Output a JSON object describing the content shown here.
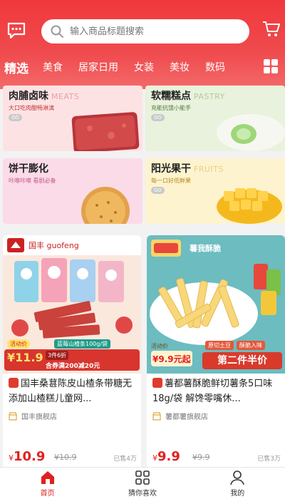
{
  "search": {
    "placeholder": "输入商品标题搜索"
  },
  "tabs": [
    "精选",
    "美食",
    "居家日用",
    "女装",
    "美妆",
    "数码"
  ],
  "categories": [
    {
      "title": "肉脯卤味",
      "en": "MEATS",
      "sub": "大口吃肉酣畅淋漓",
      "tag": "GO"
    },
    {
      "title": "软糯糕点",
      "en": "PASTRY",
      "sub": "充能抗饿小能手",
      "tag": "GO"
    },
    {
      "title": "饼干膨化",
      "en": "",
      "sub": "咔嚓咔嚓 看剧必备",
      "tag": "GO"
    },
    {
      "title": "阳光果干",
      "en": "FRUITS",
      "sub": "每一口好低鲜果",
      "tag": "GO"
    }
  ],
  "products": [
    {
      "title": "国丰桑葚陈皮山楂条带糖无添加山楂糕儿童网...",
      "shop": "国丰旗舰店",
      "price_symbol": "¥",
      "price": "10.9",
      "original": "¥10.9",
      "sold": "已售4万",
      "banner_brand": "国丰 guofeng",
      "banner_promo_label": "活动价",
      "banner_price": "¥11.9",
      "banner_promo": "3件6折",
      "banner_deal": "含券满200减20元",
      "banner_pack": "蓝莓山楂条100g/袋"
    },
    {
      "title": "薯都薯酥脆鲜切薯条5口味18g/袋 解馋零嘴休...",
      "shop": "薯都薯旗舰店",
      "price_symbol": "¥",
      "price": "9.9",
      "original": "¥9.9",
      "sold": "已售3万",
      "banner_brand": "薯我酥脆",
      "banner_promo_label": "活动价",
      "banner_price": "¥9.9元起",
      "banner_promo": "第二件半价",
      "banner_chip1": "原切土豆",
      "banner_chip2": "酥脆入味"
    }
  ],
  "nav": [
    "首页",
    "猜你喜欢",
    "我的"
  ],
  "colors": {
    "accent": "#e0211f",
    "header": "#f0383c"
  }
}
